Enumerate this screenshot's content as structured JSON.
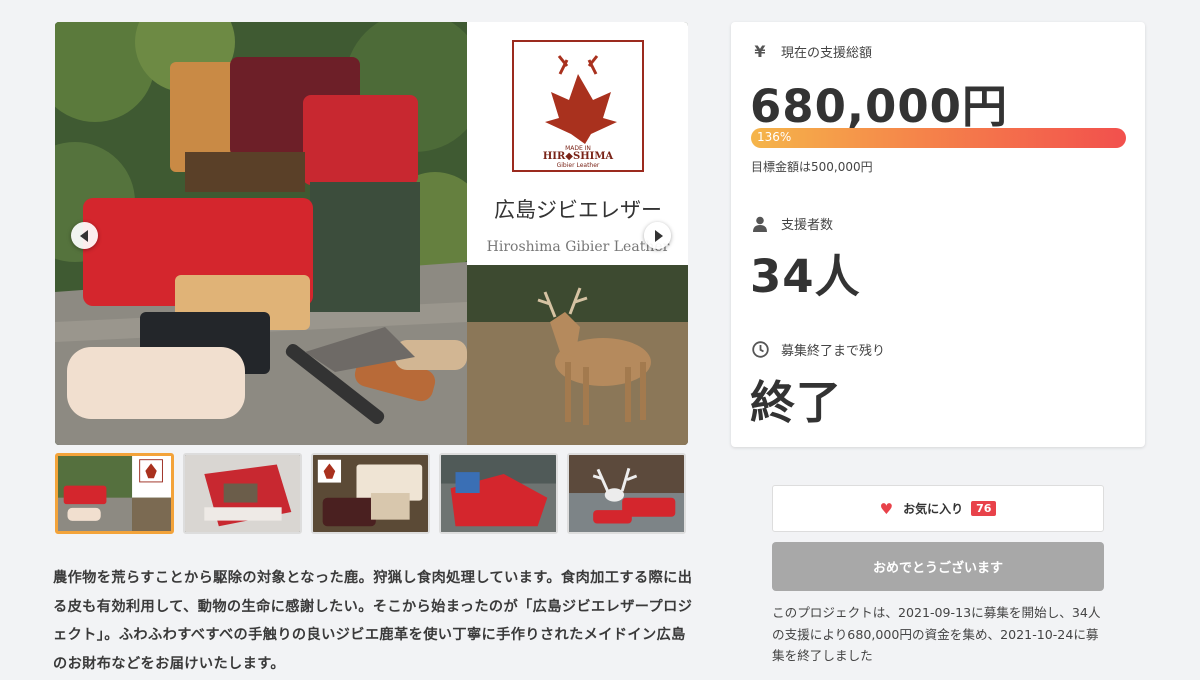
{
  "gallery": {
    "logo_made_in": "MADE IN",
    "logo_city": "HIR◆SHIMA",
    "logo_sub": "Gibier Leather",
    "brand_jp": "広島ジビエレザー",
    "brand_en": "Hiroshima Gibier Leather",
    "active_thumbnail": 1,
    "thumbnail_count": 5
  },
  "description": "農作物を荒らすことから駆除の対象となった鹿。狩猟し食肉処理しています。食肉加工する際に出る皮も有効利用して、動物の生命に感謝したい。そこから始まったのが「広島ジビエレザープロジェクト」。ふわふわすべすべの手触りの良いジビエ鹿革を使い丁寧に手作りされたメイドイン広島のお財布などをお届けいたします。",
  "stats": {
    "total_label": "現在の支援総額",
    "total_icon": "yen-icon",
    "total_value": "680,000円",
    "progress_text": "136%",
    "progress_percent": 136,
    "goal_text": "目標金額は500,000円",
    "supporters_label": "支援者数",
    "supporters_icon": "person-icon",
    "supporters_value": "34人",
    "remaining_label": "募集終了まで残り",
    "remaining_icon": "clock-icon",
    "remaining_value": "終了"
  },
  "actions": {
    "favorite_label": "お気に入り",
    "favorite_count": "76",
    "congrats_label": "おめでとうございます"
  },
  "summary": "このプロジェクトは、2021-09-13に募集を開始し、34人の支援により680,000円の資金を集め、2021-10-24に募集を終了しました",
  "colors": {
    "accent_red": "#e8424a",
    "progress_start": "#f5b54a",
    "progress_end": "#f2504d",
    "active_thumb_border": "#f3a33a"
  }
}
